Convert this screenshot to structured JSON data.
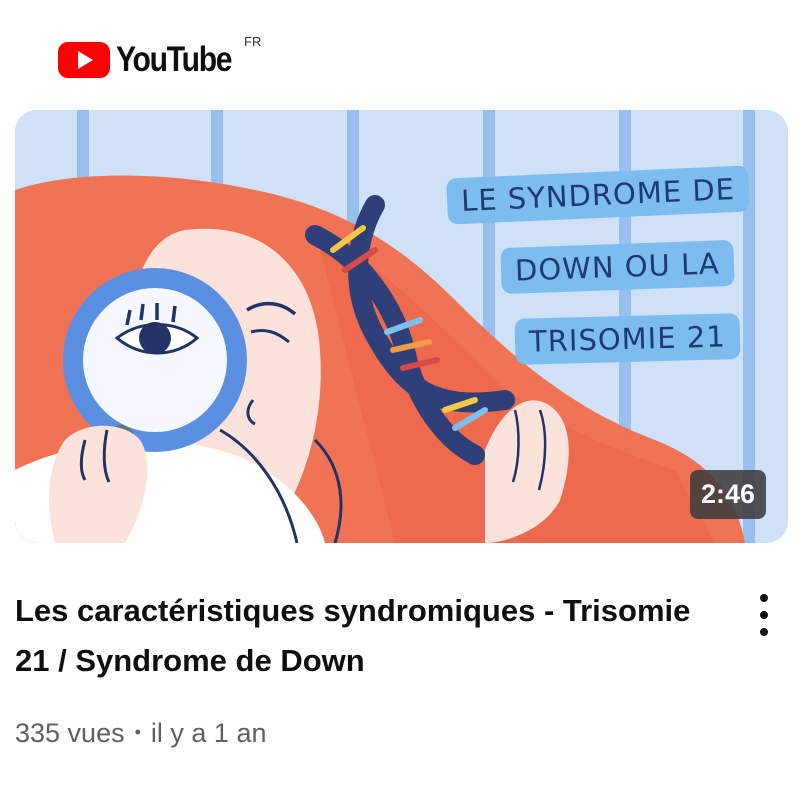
{
  "header": {
    "logo_text": "YouTube",
    "region": "FR",
    "logo_color": "#ff0000",
    "logo_icon": "youtube-play-icon"
  },
  "video": {
    "thumbnail_text": [
      "LE SYNDROME DE",
      "DOWN OU LA",
      "TRISOMIE 21"
    ],
    "duration": "2:46",
    "title": "Les caractéristiques syndromiques - Trisomie 21 / Syndrome de Down",
    "views": "335 vues",
    "separator": "•",
    "age": "il y a 1 an",
    "menu_icon": "more-vert-icon"
  },
  "colors": {
    "thumb_background": "#cfe1f6",
    "hair": "#f07356",
    "skin": "#fbe3dc",
    "dna": "#2f3f7a",
    "label_bg": "#7cbcef",
    "meta_text": "#606060"
  }
}
